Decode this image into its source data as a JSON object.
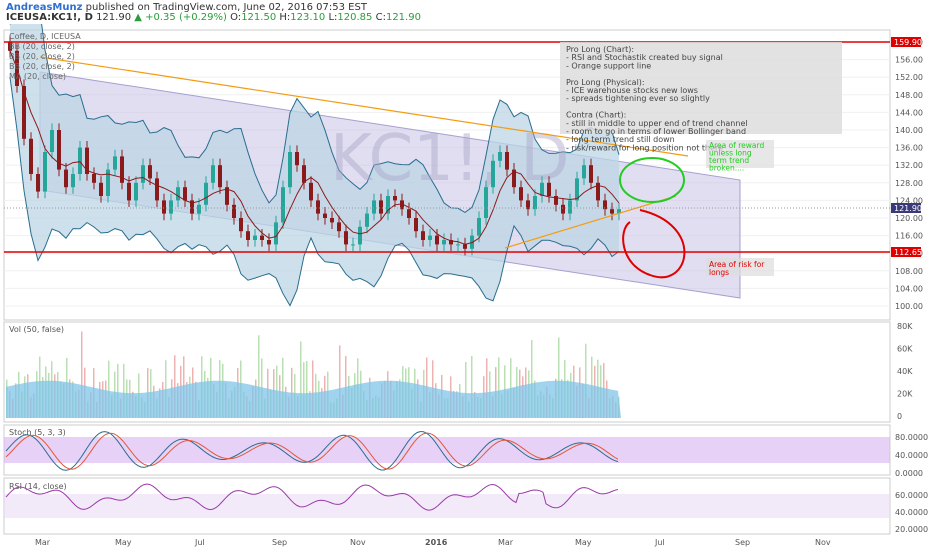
{
  "header": {
    "author": "AndreasMunz",
    "published_text": "published on TradingView.com, June 02, 2016 07:53 EST",
    "symbol": "ICEUSA:KC1!, D",
    "last": "121.90",
    "change_arrow": "▲",
    "change": "+0.35 (+0.29%)",
    "o_label": "O:",
    "o": "121.50",
    "h_label": "H:",
    "h": "123.10",
    "l_label": "L:",
    "l": "120.85",
    "c_label": "C:",
    "c": "121.90"
  },
  "legend": {
    "symbol": "Coffee, D, ICEUSA",
    "bb1": "BB (20, close, 2)",
    "bb2": "BB (20, close, 2)",
    "bb3": "BB (20, close, 2)",
    "ma": "MA (20, close)"
  },
  "watermark": "KC1!, D",
  "notes": {
    "lines": [
      "Pro Long (Chart):",
      "- RSI and Stochastik created buy signal",
      "- Orange support line",
      "",
      "Pro Long (Physical):",
      "- ICE warehouse stocks new lows",
      "- spreads tightening ever so slightly",
      "",
      "Contra (Chart):",
      "- still in middle to upper end of trend channel",
      "- room to go in terms of lower Bollinger band",
      "- long term trend still down",
      "- risk/reward for long position not there"
    ]
  },
  "annotations": {
    "reward": [
      "Area of reward",
      "unless long",
      "term trend",
      "broken...."
    ],
    "risk": [
      "Area of risk for",
      "longs"
    ]
  },
  "panels": {
    "vol_label": "Vol (50, false)",
    "stoch_label": "Stoch (5, 3, 3)",
    "rsi_label": "RSI (14, close)"
  },
  "colors": {
    "candle_up": "#26a69a",
    "candle_down": "#8b1a1a",
    "channel_fill": "#c9c3e6",
    "bb_fill": "#bcd6e4",
    "bb_line": "#2a6d8f",
    "ma_line": "#8b1a1a",
    "resistance": "#e00000",
    "trend_orange": "#f39c12",
    "reward_circle": "#22cc22",
    "risk_circle": "#e00000",
    "volume_area": "#7fc4e8",
    "stoch_band": "#d9b3f0",
    "rsi_line": "#9b3aa8"
  },
  "chart_data": {
    "type": "candlestick",
    "title": "Coffee, D, ICEUSA",
    "price_axis_ticks": [
      "160.00",
      "156.00",
      "152.00",
      "148.00",
      "144.00",
      "140.00",
      "136.00",
      "132.00",
      "128.00",
      "124.00",
      "120.00",
      "116.00",
      "112.00",
      "108.00",
      "104.00",
      "100.00"
    ],
    "price_tags": {
      "resistance": "159.90",
      "last": "121.90",
      "support": "112.65"
    },
    "time_axis": [
      "Mar",
      "May",
      "Jul",
      "Sep",
      "Nov",
      "2016",
      "Mar",
      "May",
      "Jul",
      "Sep",
      "Nov"
    ],
    "volume_axis": [
      "80K",
      "60K",
      "40K",
      "20K",
      "0"
    ],
    "stoch_axis": [
      "80.0000",
      "40.0000",
      "0.0000"
    ],
    "rsi_axis": [
      "60.0000",
      "40.0000",
      "20.0000"
    ],
    "horizontal_levels": {
      "resistance": 159.9,
      "support": 112.65,
      "last": 121.9
    },
    "approx_closes": [
      158,
      150,
      138,
      130,
      126,
      135,
      140,
      131,
      127,
      130,
      136,
      130,
      128,
      125,
      131,
      134,
      128,
      124,
      128,
      132,
      129,
      124,
      121,
      124,
      127,
      124,
      121,
      123,
      128,
      132,
      127,
      123,
      120,
      117,
      115,
      116,
      115,
      114,
      119,
      127,
      135,
      132,
      128,
      124,
      121,
      120,
      119,
      117,
      114,
      114,
      118,
      121,
      124,
      121,
      125,
      124,
      122,
      120,
      117,
      115,
      116,
      114,
      115,
      114,
      114,
      113,
      116,
      120,
      127,
      133,
      135,
      131,
      127,
      124,
      122,
      125,
      128,
      125,
      123,
      121,
      124,
      129,
      132,
      128,
      124,
      122,
      121,
      122
    ]
  }
}
